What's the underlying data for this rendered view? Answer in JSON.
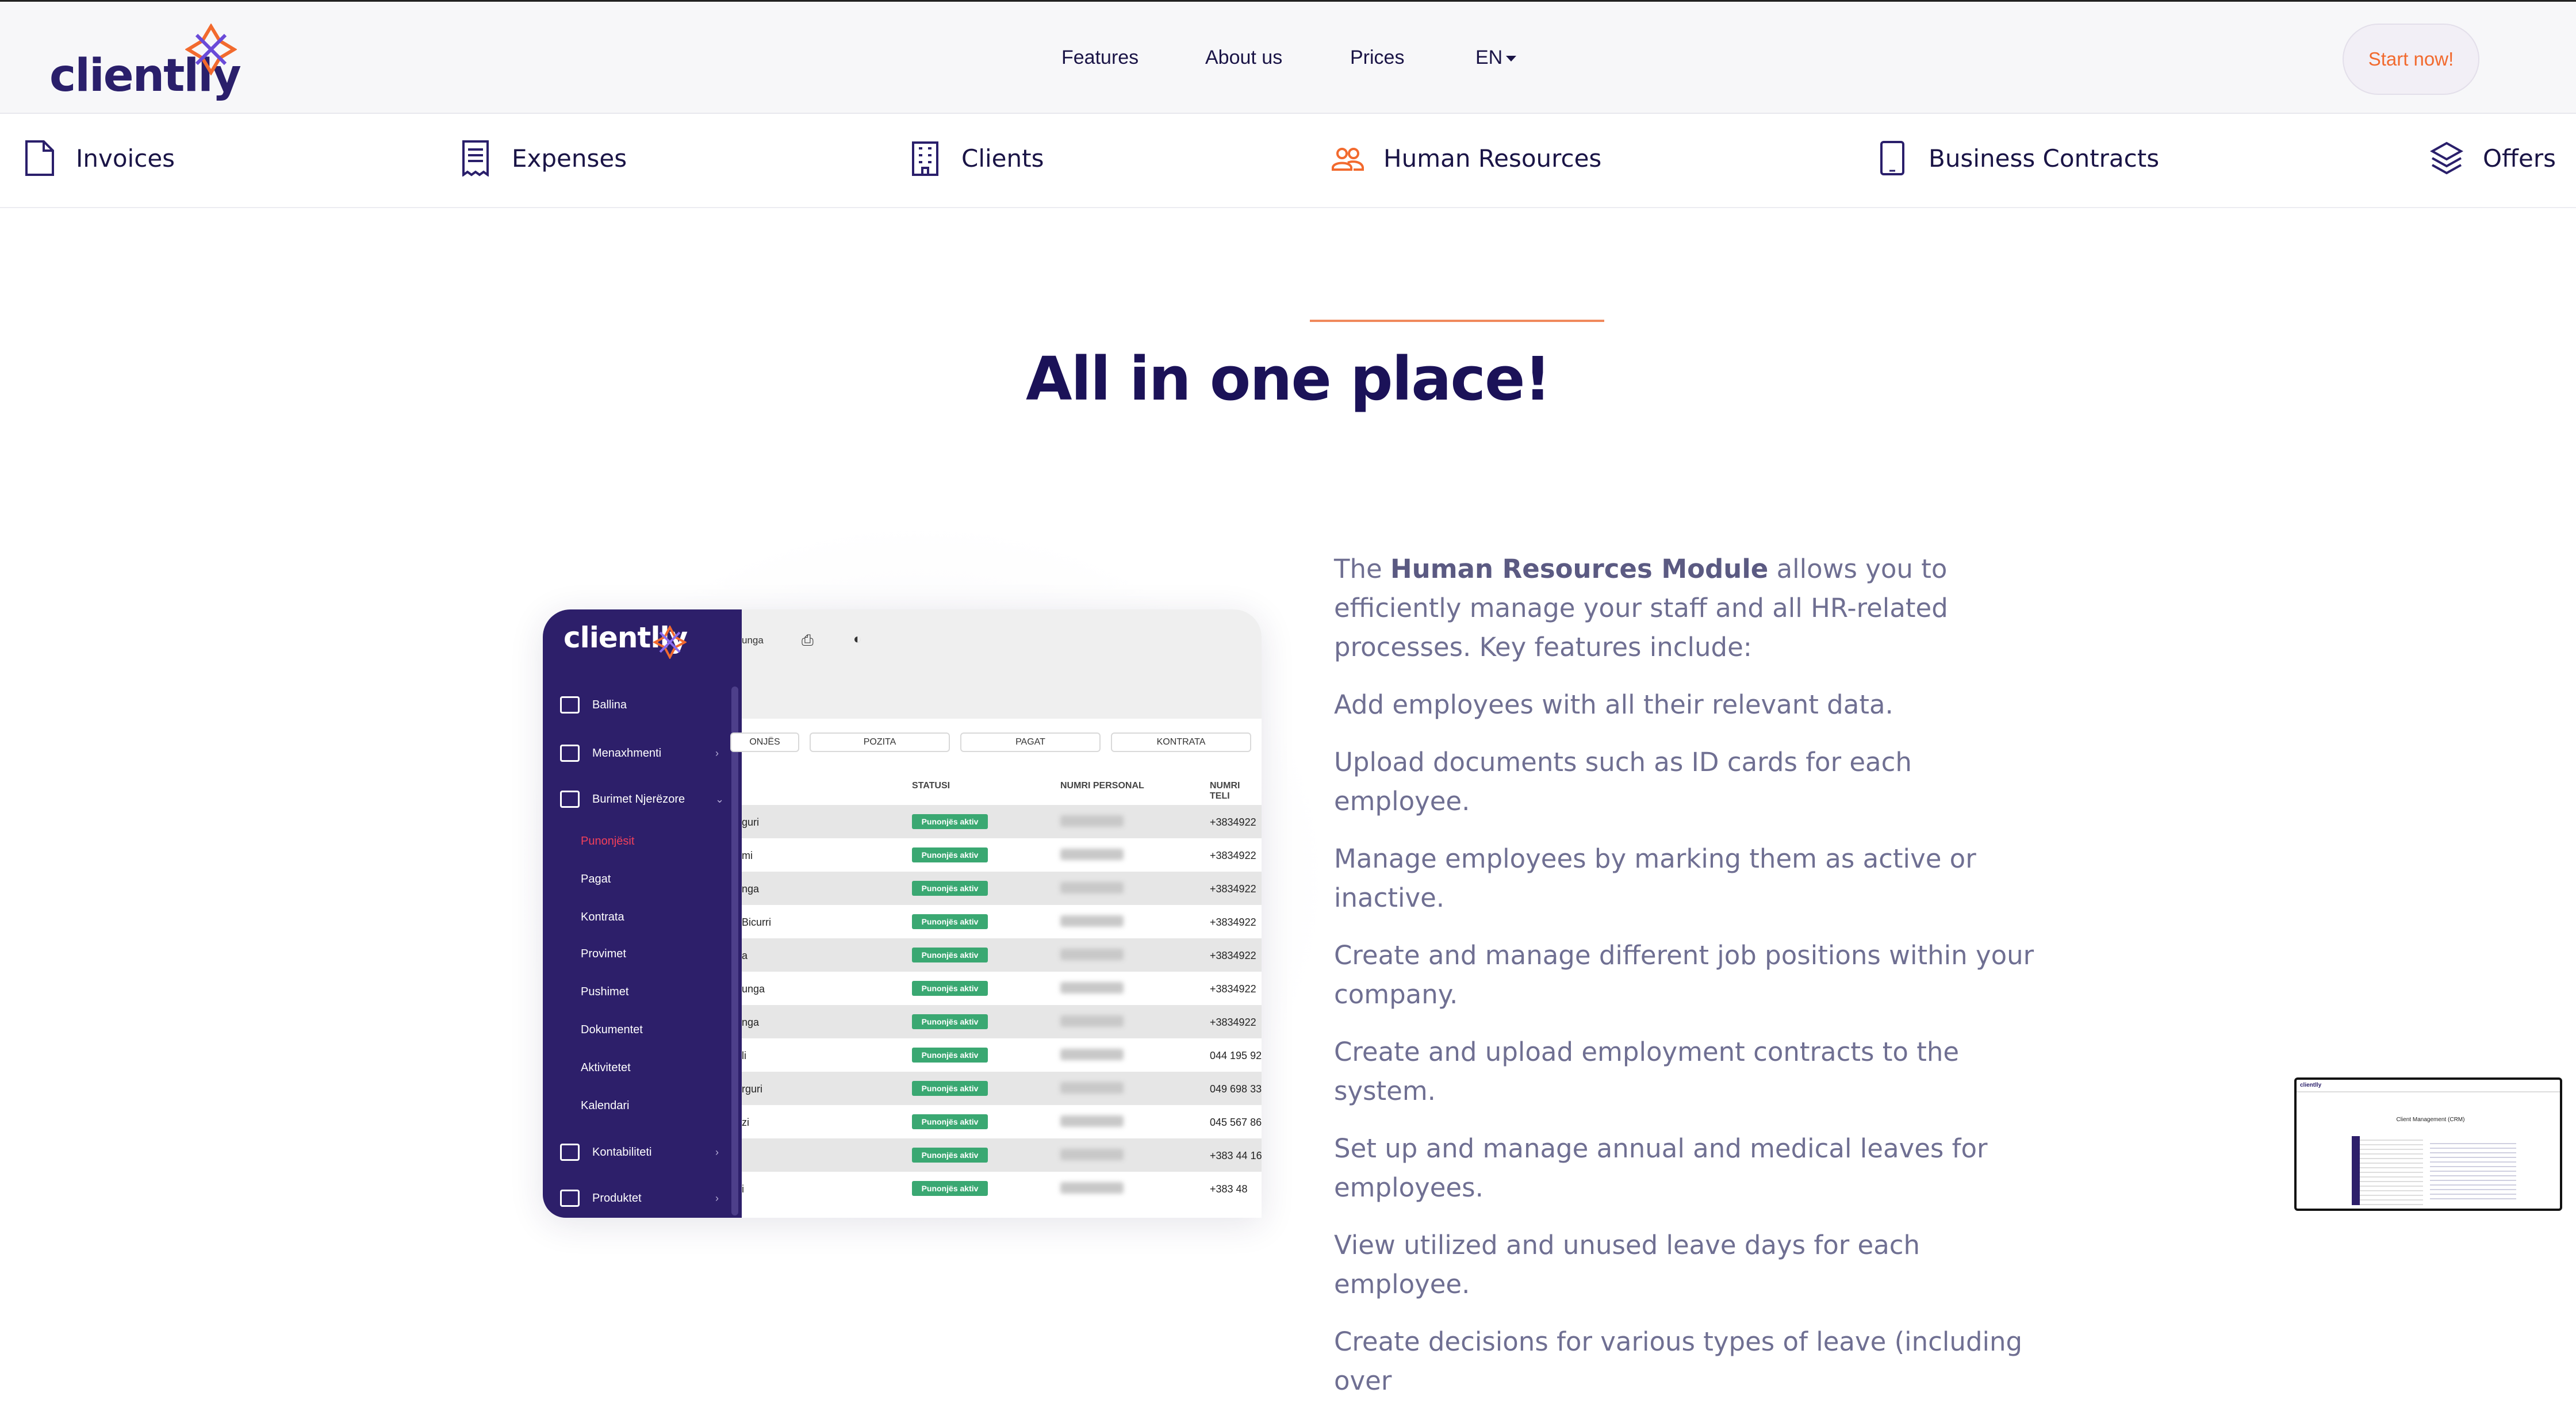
{
  "header": {
    "logo_text": "clientlly",
    "nav": {
      "features": "Features",
      "about": "About us",
      "prices": "Prices",
      "lang": "EN"
    },
    "cta": "Start now!"
  },
  "modules": {
    "invoices": "Invoices",
    "expenses": "Expenses",
    "clients": "Clients",
    "hr": "Human Resources",
    "contracts": "Business Contracts",
    "offers": "Offers"
  },
  "colors": {
    "accent": "#f26a2e",
    "brand": "#2d1f6a",
    "heading": "#1b1258"
  },
  "headline": "All in one place!",
  "screenshot": {
    "logo_text": "clientlly",
    "toolbar_text": "unga",
    "sidebar": {
      "home": "Ballina",
      "management": "Menaxhmenti",
      "hr": "Burimet Njerëzore",
      "sub": [
        "Punonjësit",
        "Pagat",
        "Kontrata",
        "Provimet",
        "Pushimet",
        "Dokumentet",
        "Aktivitetet",
        "Kalendari"
      ],
      "accounting": "Kontabiliteti",
      "products": "Produktet"
    },
    "tabs": [
      "ONJËS",
      "POZITA",
      "PAGAT",
      "KONTRATA"
    ],
    "columns": [
      "STATUSI",
      "NUMRI PERSONAL",
      "NUMRI TELI"
    ],
    "rows": [
      {
        "name": "guri",
        "status": "Punonjës aktiv",
        "phone": "+3834922"
      },
      {
        "name": "mi",
        "status": "Punonjës aktiv",
        "phone": "+3834922"
      },
      {
        "name": "nga",
        "status": "Punonjës aktiv",
        "phone": "+3834922"
      },
      {
        "name": "Bicurri",
        "status": "Punonjës aktiv",
        "phone": "+3834922"
      },
      {
        "name": "a",
        "status": "Punonjës aktiv",
        "phone": "+3834922"
      },
      {
        "name": "unga",
        "status": "Punonjës aktiv",
        "phone": "+3834922"
      },
      {
        "name": "nga",
        "status": "Punonjës aktiv",
        "phone": "+3834922"
      },
      {
        "name": "li",
        "status": "Punonjës aktiv",
        "phone": "044 195 92"
      },
      {
        "name": "rguri",
        "status": "Punonjës aktiv",
        "phone": "049 698 33"
      },
      {
        "name": "zi",
        "status": "Punonjës aktiv",
        "phone": "045 567 86"
      },
      {
        "name": "",
        "status": "Punonjës aktiv",
        "phone": "+383 44 16"
      },
      {
        "name": "i",
        "status": "Punonjës aktiv",
        "phone": "+383 48"
      }
    ]
  },
  "description": {
    "intro_pre": "The ",
    "intro_bold": "Human Resources Module",
    "intro_post": " allows you to efficiently manage your staff and all HR-related processes. Key features include:",
    "features": [
      "Add employees with all their relevant data.",
      "Upload documents such as ID cards for each employee.",
      "Manage employees by marking them as active or inactive.",
      "Create and manage different job positions within your company.",
      "Create and upload employment contracts to the system.",
      "Set up and manage annual and medical leaves for employees.",
      "View utilized and unused leave days for each employee.",
      "Create decisions for various types of leave (including over"
    ]
  },
  "thumbnail": {
    "title": "Client Management (CRM)",
    "logo": "clientlly"
  }
}
